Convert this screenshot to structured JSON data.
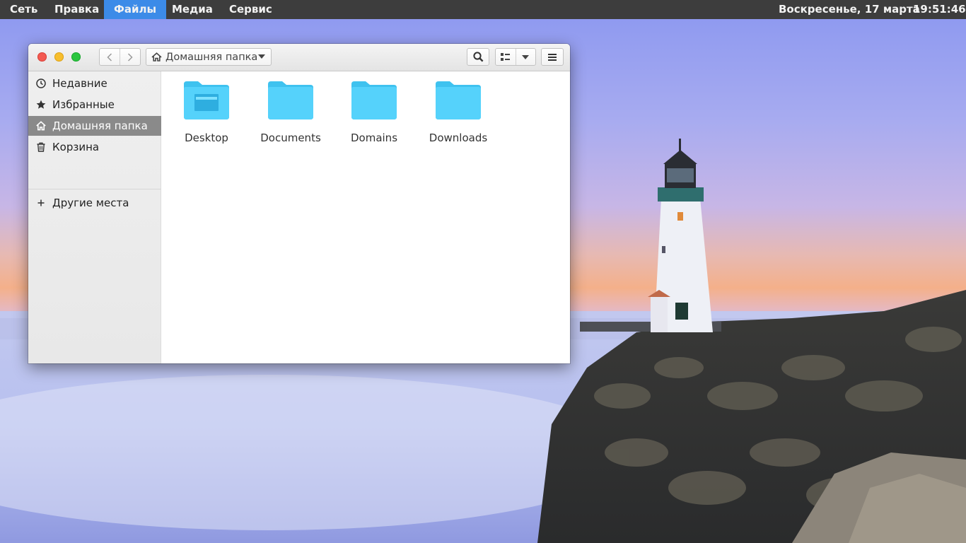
{
  "panel": {
    "menus": [
      "Сеть",
      "Правка",
      "Файлы",
      "Медиа",
      "Сервис"
    ],
    "active_menu": "Файлы",
    "date": "Воскресенье, 17 марта",
    "time": "19:51:46"
  },
  "window": {
    "location": {
      "icon": "home-icon",
      "label": "Домашняя папка"
    },
    "sidebar": {
      "items": [
        {
          "label": "Недавние",
          "icon": "clock-icon"
        },
        {
          "label": "Избранные",
          "icon": "star-icon"
        },
        {
          "label": "Домашняя папка",
          "icon": "home-icon",
          "selected": true
        },
        {
          "label": "Корзина",
          "icon": "trash-icon"
        }
      ],
      "other_places": {
        "label": "Другие места",
        "icon": "plus-icon"
      }
    },
    "files": [
      {
        "name": "Desktop",
        "icon": "desktop-folder-icon"
      },
      {
        "name": "Documents",
        "icon": "folder-icon"
      },
      {
        "name": "Domains",
        "icon": "folder-icon"
      },
      {
        "name": "Downloads",
        "icon": "folder-icon"
      }
    ]
  },
  "colors": {
    "panel_bg": "#3d3d3d",
    "active_menu": "#3c8be8",
    "folder": "#4fd0fb",
    "selection": "#8a8a8a"
  }
}
